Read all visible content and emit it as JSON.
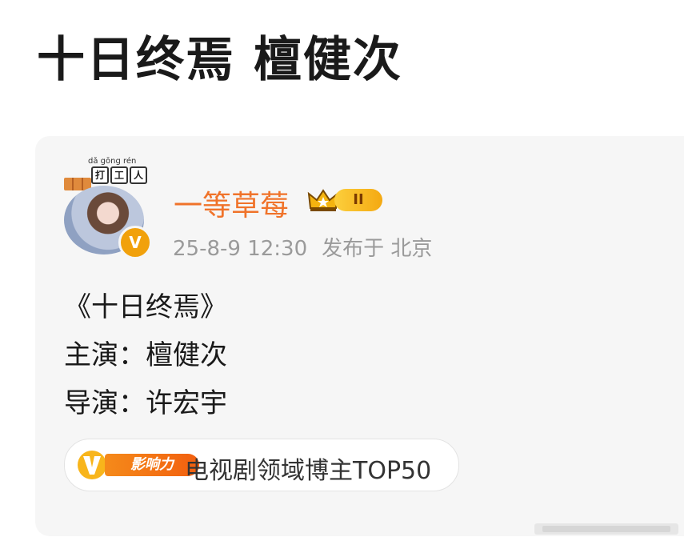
{
  "headline": "十日终焉 檀健次",
  "post": {
    "badge_pinyin": "dǎ gōng rén",
    "badge_chars": [
      "打",
      "工",
      "人"
    ],
    "author": "一等草莓",
    "level": "II",
    "timestamp": "25-8-9 12:30",
    "location_label": "发布于 北京",
    "lines": [
      "《十日终焉》",
      "主演：檀健次",
      "导演：许宏宇"
    ],
    "influence_tag": "影响力",
    "influence_text": "电视剧领域博主TOP50"
  },
  "colors": {
    "accent": "#f0732a",
    "verified": "#f1a10c",
    "meta": "#9a9a9a"
  },
  "icons": [
    "crown-icon",
    "verified-icon",
    "influence-v-icon",
    "worker-badge-icon"
  ]
}
